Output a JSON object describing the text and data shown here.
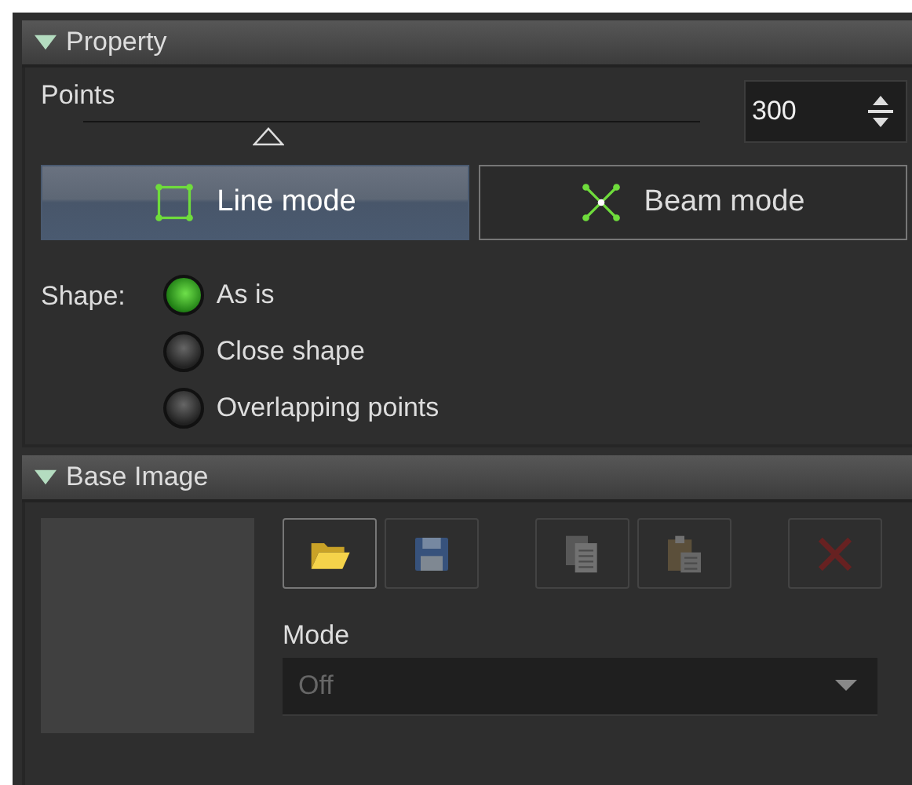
{
  "property": {
    "title": "Property",
    "expanded": true,
    "points": {
      "label": "Points",
      "level": 0.3,
      "value": "300"
    },
    "modes": [
      {
        "label": "Line mode",
        "kind": "line",
        "selected": true
      },
      {
        "label": "Beam mode",
        "kind": "beam",
        "selected": false
      }
    ],
    "shape": {
      "label": "Shape:",
      "options": [
        {
          "label": "As is",
          "selected": true
        },
        {
          "label": "Close shape",
          "selected": false
        },
        {
          "label": "Overlapping points",
          "selected": false
        }
      ]
    }
  },
  "base_image": {
    "title": "Base Image",
    "expanded": true,
    "tools": [
      {
        "kind": "open",
        "disabled": false
      },
      {
        "kind": "save",
        "disabled": true
      },
      {
        "kind": "copy",
        "disabled": true
      },
      {
        "kind": "paste",
        "disabled": true
      },
      {
        "kind": "delete",
        "disabled": true
      }
    ],
    "mode": {
      "label": "Mode",
      "value": "Off",
      "disabled": true
    }
  }
}
